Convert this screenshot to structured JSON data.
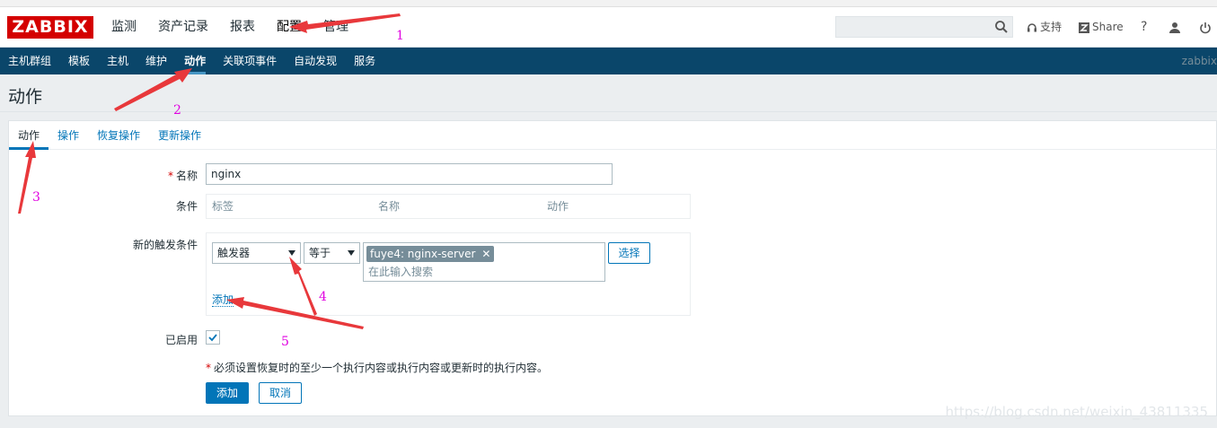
{
  "header": {
    "logo": "ZABBIX",
    "menu": [
      {
        "label": "监测"
      },
      {
        "label": "资产记录"
      },
      {
        "label": "报表"
      },
      {
        "label": "配置"
      },
      {
        "label": "管理"
      }
    ],
    "search_value": "",
    "support_label": "支持",
    "share_label": "Share",
    "help_label": "?"
  },
  "subnav": {
    "items": [
      {
        "label": "主机群组"
      },
      {
        "label": "模板"
      },
      {
        "label": "主机"
      },
      {
        "label": "维护"
      },
      {
        "label": "动作"
      },
      {
        "label": "关联项事件"
      },
      {
        "label": "自动发现"
      },
      {
        "label": "服务"
      }
    ],
    "server_name": "zabbix"
  },
  "page": {
    "title": "动作",
    "tabs": [
      {
        "label": "动作"
      },
      {
        "label": "操作"
      },
      {
        "label": "恢复操作"
      },
      {
        "label": "更新操作"
      }
    ]
  },
  "form": {
    "name_label": "名称",
    "name_required": "*",
    "name_value": "nginx",
    "conditions_label": "条件",
    "conditions_headers": [
      "标签",
      "名称",
      "动作"
    ],
    "new_condition_label": "新的触发条件",
    "condition_type": "触发器",
    "condition_operator": "等于",
    "selected_chip": "fuye4: nginx-server",
    "chip_remove": "✕",
    "search_placeholder": "在此输入搜索",
    "select_button": "选择",
    "add_link": "添加",
    "enabled_label": "已启用",
    "enabled": true,
    "note_star": "*",
    "required_note": "必须设置恢复时的至少一个执行内容或执行内容或更新时的执行内容。",
    "add_button": "添加",
    "cancel_button": "取消"
  },
  "annotations": {
    "numbers": [
      "1",
      "2",
      "3",
      "4",
      "5"
    ],
    "arrow_color": "#e8383b"
  },
  "watermark": "https://blog.csdn.net/weixin_43811335",
  "colors": {
    "logo_red": "#d40000",
    "subnav_bg": "#0a466a",
    "link_blue": "#0275b8",
    "chip_gray": "#768d99"
  }
}
